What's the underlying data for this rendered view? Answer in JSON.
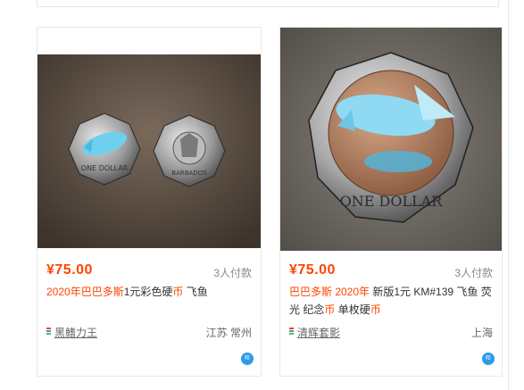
{
  "items": [
    {
      "price": "¥75.00",
      "paid_count": "3人付款",
      "title_parts": [
        {
          "text": "2020年巴巴多斯",
          "hl": true
        },
        {
          "text": "1元彩色硬",
          "hl": false
        },
        {
          "text": "币",
          "hl": true
        },
        {
          "text": " 飞鱼",
          "hl": false
        }
      ],
      "shop_name": "黑鳍力王",
      "location": "江苏 常州",
      "image_desc": "two coins",
      "wangwang_icon": "chat-bubble-icon"
    },
    {
      "price": "¥75.00",
      "paid_count": "3人付款",
      "title_parts": [
        {
          "text": "巴巴多斯 2020年",
          "hl": true
        },
        {
          "text": " 新版1元 KM#139 飞鱼 荧光 纪念",
          "hl": false
        },
        {
          "text": "币",
          "hl": true
        },
        {
          "text": " 单枚硬",
          "hl": false
        },
        {
          "text": "币",
          "hl": true
        }
      ],
      "shop_name": "清辉套影",
      "location": "上海",
      "image_desc": "single coin",
      "wangwang_icon": "chat-bubble-icon"
    }
  ],
  "colors": {
    "price": "#ff4400",
    "highlight": "#ff4400",
    "shop_icon": [
      "#ff4400",
      "#2a9ce8",
      "#5cb85c"
    ],
    "wangwang": "#2a9ce8"
  }
}
